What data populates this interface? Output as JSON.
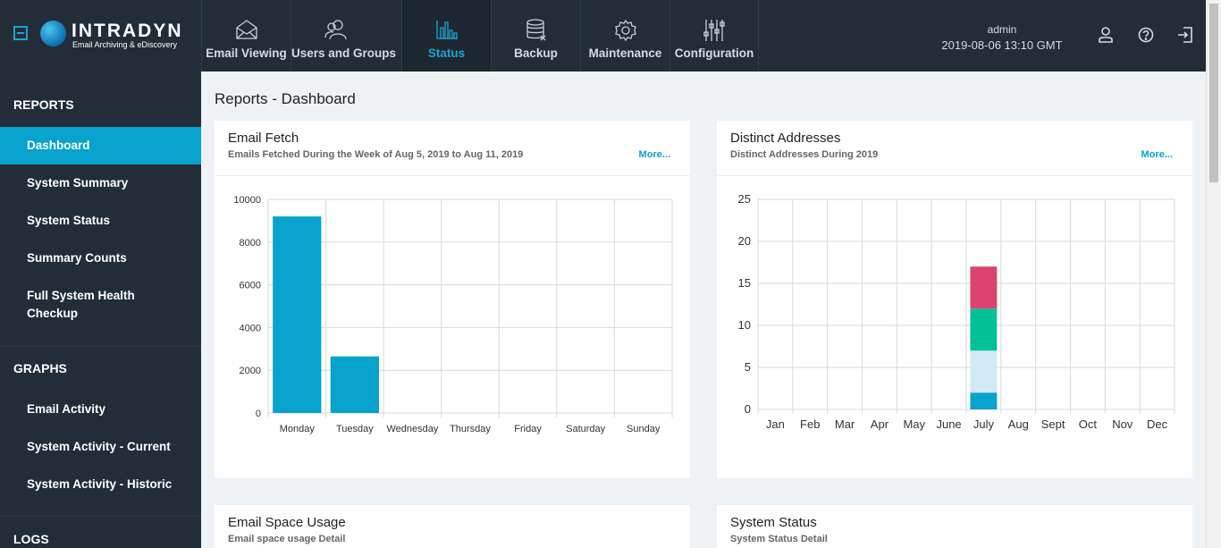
{
  "brand": {
    "name": "INTRADYN",
    "tagline": "Email Archiving & eDiscovery"
  },
  "nav": [
    {
      "label": "Email Viewing",
      "icon": "envelope-icon"
    },
    {
      "label": "Users and Groups",
      "icon": "users-icon"
    },
    {
      "label": "Status",
      "icon": "bar-chart-icon",
      "active": true
    },
    {
      "label": "Backup",
      "icon": "database-icon"
    },
    {
      "label": "Maintenance",
      "icon": "gear-icon"
    },
    {
      "label": "Configuration",
      "icon": "sliders-icon"
    }
  ],
  "user": {
    "name": "admin",
    "datetime": "2019-08-06 13:10 GMT"
  },
  "sidebar": {
    "reports_heading": "REPORTS",
    "reports": [
      {
        "label": "Dashboard",
        "active": true
      },
      {
        "label": "System Summary"
      },
      {
        "label": "System Status"
      },
      {
        "label": "Summary Counts"
      },
      {
        "label": "Full System Health Checkup"
      }
    ],
    "graphs_heading": "GRAPHS",
    "graphs": [
      {
        "label": "Email Activity"
      },
      {
        "label": "System Activity - Current"
      },
      {
        "label": "System Activity - Historic"
      }
    ],
    "logs_heading": "LOGS"
  },
  "page": {
    "title": "Reports - Dashboard"
  },
  "cards": {
    "email_fetch": {
      "title": "Email Fetch",
      "subtitle": "Emails Fetched During the Week of Aug 5, 2019 to Aug 11, 2019",
      "more": "More..."
    },
    "distinct": {
      "title": "Distinct Addresses",
      "subtitle": "Distinct Addresses During 2019",
      "more": "More..."
    },
    "space": {
      "title": "Email Space Usage",
      "subtitle": "Email space usage Detail"
    },
    "status": {
      "title": "System Status",
      "subtitle": "System Status Detail"
    }
  },
  "colors": {
    "accent": "#07a3cd",
    "nav_bg": "#232d38",
    "seg1": "#07a3cd",
    "seg2": "#d3e9f3",
    "seg3": "#03c196",
    "seg4": "#dd436f"
  },
  "chart_data": [
    {
      "type": "bar",
      "title": "Email Fetch",
      "categories": [
        "Monday",
        "Tuesday",
        "Wednesday",
        "Thursday",
        "Friday",
        "Saturday",
        "Sunday"
      ],
      "values": [
        9200,
        2650,
        0,
        0,
        0,
        0,
        0
      ],
      "ylim": [
        0,
        10000
      ],
      "yticks": [
        0,
        2000,
        4000,
        6000,
        8000,
        10000
      ],
      "grid": true
    },
    {
      "type": "bar",
      "stacked": true,
      "title": "Distinct Addresses",
      "categories": [
        "Jan",
        "Feb",
        "Mar",
        "Apr",
        "May",
        "June",
        "July",
        "Aug",
        "Sept",
        "Oct",
        "Nov",
        "Dec"
      ],
      "series": [
        {
          "values": [
            0,
            0,
            0,
            0,
            0,
            0,
            2,
            0,
            0,
            0,
            0,
            0
          ]
        },
        {
          "values": [
            0,
            0,
            0,
            0,
            0,
            0,
            5,
            0,
            0,
            0,
            0,
            0
          ]
        },
        {
          "values": [
            0,
            0,
            0,
            0,
            0,
            0,
            5,
            0,
            0,
            0,
            0,
            0
          ]
        },
        {
          "values": [
            0,
            0,
            0,
            0,
            0,
            0,
            5,
            0,
            0,
            0,
            0,
            0
          ]
        }
      ],
      "ylim": [
        0,
        25
      ],
      "yticks": [
        0,
        5,
        10,
        15,
        20,
        25
      ],
      "grid": true
    }
  ]
}
